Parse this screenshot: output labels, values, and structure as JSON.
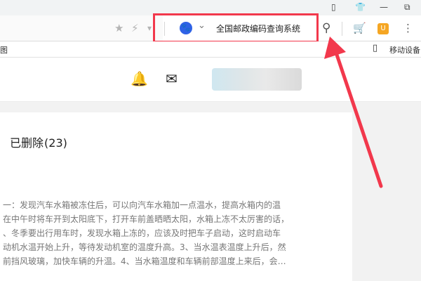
{
  "window_controls": {
    "restore": "▯",
    "shirt": "👕",
    "minimize": "—",
    "maximize": "⧉"
  },
  "address_bar": {
    "star_icon": "★",
    "bolt_icon": "⚡",
    "dropdown_icon": "▾",
    "engine_icon": "🐾",
    "engine_chevron": "⌄",
    "search_text": "全国邮政编码查询系统",
    "search_icon": "⚲",
    "cart_icon": "🛒",
    "extension_icon": "U",
    "menu_icon": "⋮"
  },
  "bookmarks": {
    "left_fragment": "图",
    "phone_icon": "▯",
    "right_label": "移动设备"
  },
  "site_header": {
    "bell_icon": "🔔",
    "mail_icon": "✉"
  },
  "mailbox": {
    "folder_name": "已删除",
    "folder_count": "(23)",
    "preview_lines": [
      "一：发现汽车水箱被冻住后，可以向汽车水箱加一点温水，提高水箱内的温",
      "在中午时将车开到太阳底下，打开车前盖晒晒太阳，水箱上冻不太厉害的话，",
      "、冬季要出行用车时，发现水箱上冻的，应该及时把车子启动，这时启动车",
      "动机水温开始上升，等待发动机室的温度升高。3、当水温表温度上升后，然",
      "前挡风玻璃，加快车辆的升温。4、当水箱温度和车辆前部温度上来后，会…"
    ]
  },
  "colors": {
    "highlight": "#f2384c",
    "engine_blue": "#2f62e6",
    "extension_yellow": "#f5a623"
  }
}
